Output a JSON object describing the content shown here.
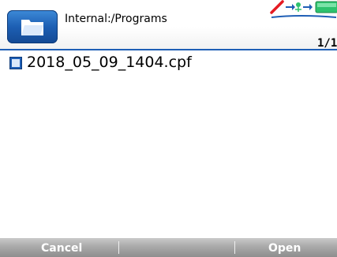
{
  "header": {
    "path": "Internal:/Programs",
    "page_indicator": "1/1"
  },
  "files": [
    {
      "name": "2018_05_09_1404.cpf"
    }
  ],
  "softkeys": {
    "left": "Cancel",
    "right": "Open"
  },
  "icons": {
    "folder": "folder-icon",
    "file": "file-icon",
    "no-probe": "red-slash-icon",
    "connection": "usb-connection-icon",
    "battery": "battery-icon"
  },
  "colors": {
    "accent": "#1f5fb6",
    "battery": "#2ec26e",
    "softkey_bar": "#a9a9a9"
  }
}
